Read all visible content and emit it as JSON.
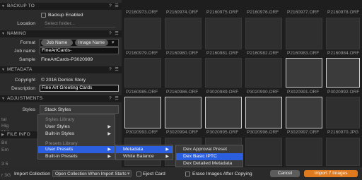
{
  "sections": {
    "backup": {
      "title": "BACKUP TO",
      "q": "?",
      "hb": "☰",
      "checkbox_label": "Backup Enabled",
      "location_label": "Location",
      "location_placeholder": "Select folder..."
    },
    "naming": {
      "title": "NAMING",
      "q": "?",
      "hb": "☰",
      "format_label": "Format",
      "tokens": [
        "Job Name",
        "Image Name"
      ],
      "jobname_label": "Job name",
      "jobname_value": "FineArtCards-",
      "sample_label": "Sample",
      "sample_value": "FineArtCards-P3020989"
    },
    "metadata": {
      "title": "METADATA",
      "q": "?",
      "hb": "☰",
      "copyright_label": "Copyright",
      "copyright_value": "© 2016 Derrick Story",
      "description_label": "Description",
      "description_value": "Fine Art Greeting Cards"
    },
    "adjustments": {
      "title": "ADJUSTMENTS",
      "q": "?",
      "hb": "☰",
      "styles_label": "Styles",
      "styles_value": "Stack Styles"
    },
    "fileinfo": {
      "title": "FILE INFO"
    }
  },
  "left_fragments": [
    "tal",
    "Hig",
    "Mid",
    "Bri",
    "Em",
    "3 5",
    "r 3G"
  ],
  "menu1": {
    "items": [
      {
        "label": "Styles Library",
        "dim": true
      },
      {
        "label": "User Styles",
        "arrow": "▶"
      },
      {
        "label": "Built-in Styles",
        "arrow": "▶"
      },
      {
        "label": "Presets Library",
        "dim": true
      },
      {
        "label": "User Presets",
        "arrow": "▶",
        "hl": true
      },
      {
        "label": "Built-in Presets",
        "arrow": "▶"
      }
    ]
  },
  "menu2": {
    "items": [
      {
        "label": "Metadata",
        "arrow": "▶",
        "hl": true
      },
      {
        "label": "White Balance",
        "arrow": "▶"
      }
    ]
  },
  "menu3": {
    "items": [
      {
        "label": "Dex Approval Preset"
      },
      {
        "label": "Dex Basic IPTC",
        "hl": true
      },
      {
        "label": "Dex Detailed Metadata"
      }
    ]
  },
  "grid": {
    "top_names": [
      "P2160973.ORF",
      "P2160974.ORF",
      "P2160975.ORF",
      "P2160976.ORF",
      "P2160977.ORF",
      "P2160978.ORF"
    ],
    "rows": [
      {
        "names": [
          "P2160979.ORF",
          "P2160980.ORF",
          "P2160981.ORF",
          "P2160982.ORF",
          "P2160983.ORF",
          "P2160984.ORF"
        ]
      },
      {
        "names": [
          "P2160985.ORF",
          "P2160986.ORF",
          "P3020989.ORF",
          "P3020990.ORF",
          "P3020991.ORF",
          "P3020992.ORF"
        ]
      },
      {
        "names": [
          "P3020993.ORF",
          "P3020994.ORF",
          "P3020995.ORF",
          "P3020996.ORF",
          "P3020997.ORF",
          "P2160970.JPG"
        ]
      },
      {
        "names": [
          "",
          "",
          "",
          "",
          "",
          ""
        ]
      }
    ]
  },
  "bottom": {
    "import_collection_label": "Import Collection",
    "collection_value": "Open Collection When Import Starts",
    "eject_label": "Eject Card",
    "erase_label": "Erase Images After Copying",
    "cancel_label": "Cancel",
    "import_label": "Import 7 Images"
  },
  "colors": {
    "accent": "#e07a1f",
    "highlight": "#2c5fe0"
  }
}
